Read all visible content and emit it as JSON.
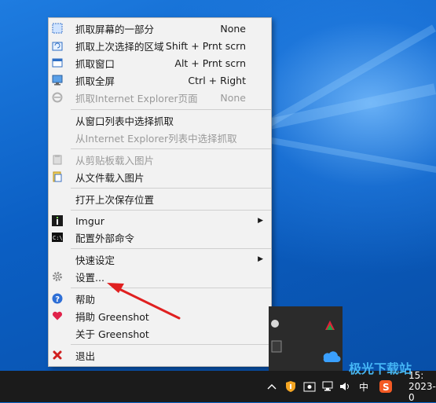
{
  "menu": {
    "items": [
      {
        "label": "抓取屏幕的一部分",
        "shortcut": "None",
        "icon": "region-select-icon"
      },
      {
        "label": "抓取上次选择的区域",
        "shortcut": "Shift + Prnt scrn",
        "icon": "last-region-icon"
      },
      {
        "label": "抓取窗口",
        "shortcut": "Alt + Prnt scrn",
        "icon": "window-capture-icon"
      },
      {
        "label": "抓取全屏",
        "shortcut": "Ctrl + Right",
        "icon": "fullscreen-capture-icon"
      },
      {
        "label": "抓取Internet Explorer页面",
        "shortcut": "None",
        "icon": "ie-icon"
      },
      {
        "label": "从窗口列表中选择抓取"
      },
      {
        "label": "从Internet Explorer列表中选择抓取"
      },
      {
        "label": "从剪贴板载入图片",
        "icon": "clipboard-icon"
      },
      {
        "label": "从文件载入图片",
        "icon": "file-icon"
      },
      {
        "label": "打开上次保存位置"
      },
      {
        "label": "Imgur",
        "icon": "imgur-icon"
      },
      {
        "label": "配置外部命令",
        "icon": "command-icon"
      },
      {
        "label": "快速设定"
      },
      {
        "label": "设置...",
        "icon": "gear-icon"
      },
      {
        "label": "帮助",
        "icon": "help-icon"
      },
      {
        "label": "捐助 Greenshot",
        "icon": "heart-icon"
      },
      {
        "label": "关于 Greenshot"
      },
      {
        "label": "退出",
        "icon": "close-icon"
      }
    ]
  },
  "taskbar": {
    "ime": "中",
    "clock_time": "15:",
    "clock_date": "2023-0"
  },
  "watermark": "极光下载站",
  "colors": {
    "menu_bg": "#f2f2f2",
    "annotation": "#e02020",
    "taskbar": "#1b1b1b"
  }
}
